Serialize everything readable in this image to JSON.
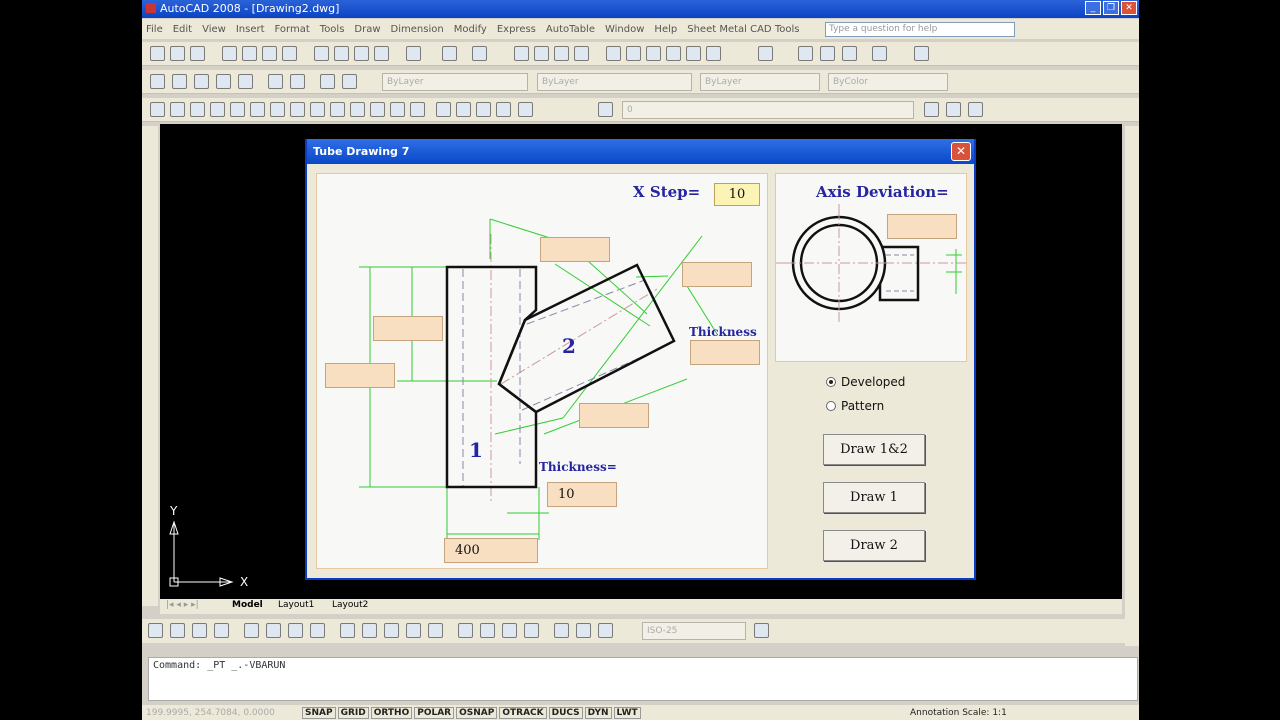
{
  "app": {
    "title": "AutoCAD 2008 - [Drawing2.dwg]"
  },
  "menu": {
    "items": [
      "File",
      "Edit",
      "View",
      "Insert",
      "Format",
      "Tools",
      "Draw",
      "Dimension",
      "Modify",
      "Express",
      "AutoTable",
      "Window",
      "Help",
      "Sheet Metal CAD Tools"
    ]
  },
  "help": {
    "placeholder": "Type a question for help"
  },
  "layers": {
    "layer": "ByLayer",
    "linetype": "ByLayer",
    "lineweight": "ByLayer",
    "color": "ByColor",
    "current_layer": "0"
  },
  "dim_style": "ISO-25",
  "tabs": [
    "Model",
    "Layout1",
    "Layout2"
  ],
  "ucs": {
    "x": "X",
    "y": "Y"
  },
  "command": {
    "text": "Command: _PT _.-VBARUN"
  },
  "status": {
    "coords": "199.9995, 254.7084, 0.0000",
    "buttons": [
      "SNAP",
      "GRID",
      "ORTHO",
      "POLAR",
      "OSNAP",
      "OTRACK",
      "DUCS",
      "DYN",
      "LWT"
    ],
    "annotation_scale": "Annotation Scale: 1:1"
  },
  "dialog": {
    "title": "Tube Drawing 7",
    "x_step_label": "X Step=",
    "x_step_value": "10",
    "axis_deviation_label": "Axis Deviation=",
    "axis_deviation_value": "",
    "thickness_label_2": "Thickness",
    "thickness_label_1": "Thickness=",
    "thickness_value": "10",
    "diameter_value": "400",
    "tube_1_label": "1",
    "tube_2_label": "2",
    "empty_fields": [
      "",
      "",
      "",
      "",
      "",
      ""
    ],
    "radio": [
      {
        "label": "Developed",
        "checked": true
      },
      {
        "label": "Pattern",
        "checked": false
      }
    ],
    "buttons": [
      "Draw 1&2",
      "Draw 1",
      "Draw 2"
    ]
  }
}
